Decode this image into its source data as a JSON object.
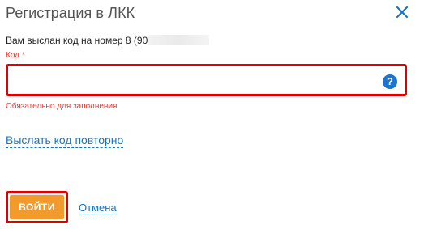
{
  "dialog": {
    "title": "Регистрация в ЛКК",
    "close_icon": "close-icon"
  },
  "message": {
    "sent_text": "Вам выслан код на номер 8 (9",
    "masked_part": "0"
  },
  "code_field": {
    "label": "Код",
    "required_mark": "*",
    "value": "",
    "placeholder": "",
    "help_icon": "question-circle-icon",
    "help_symbol": "?",
    "error_text": "Обязательно для заполнения"
  },
  "actions": {
    "resend_label": "Выслать код повторно",
    "login_label": "ВОЙТИ",
    "cancel_label": "Отмена"
  },
  "colors": {
    "accent_orange": "#f39a2c",
    "error_red": "#e53935",
    "highlight_red": "#e10000",
    "link_blue": "#1e73be",
    "help_blue": "#1976d2"
  }
}
